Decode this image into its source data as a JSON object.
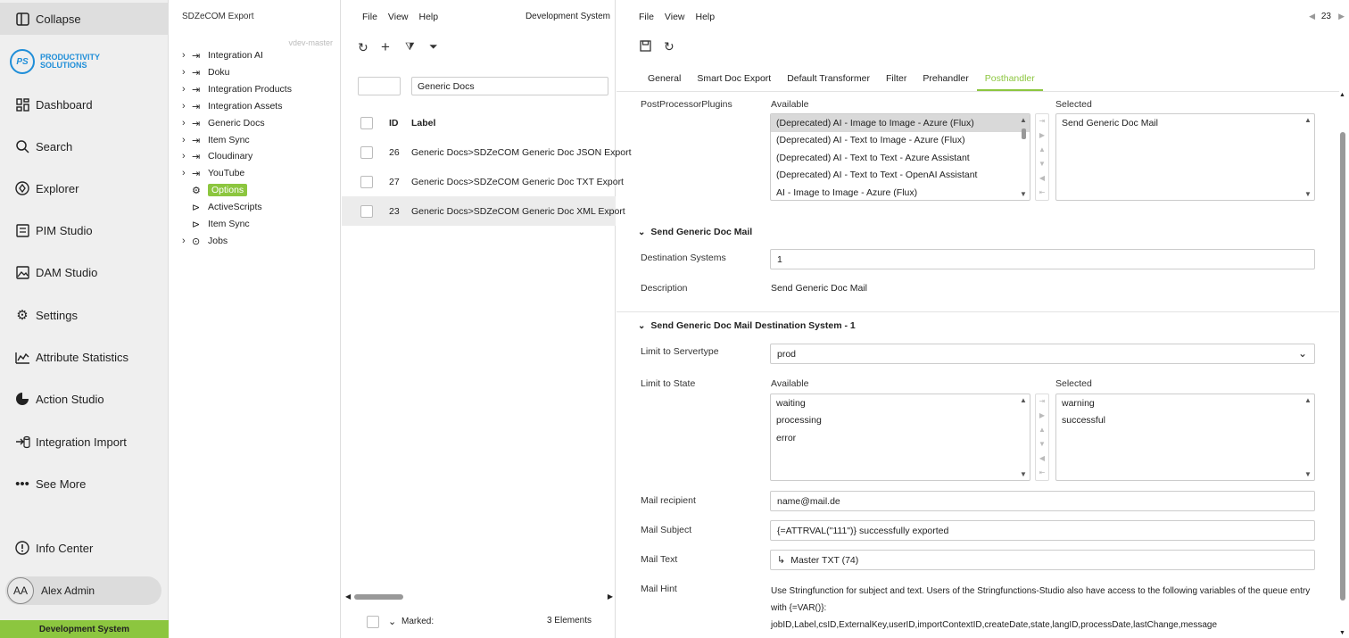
{
  "nav": {
    "collapse": "Collapse",
    "logo_initials": "PS",
    "logo_line1": "PRODUCTIVITY",
    "logo_line2": "SOLUTIONS",
    "items": [
      "Dashboard",
      "Search",
      "Explorer",
      "PIM Studio",
      "DAM Studio",
      "Settings",
      "Attribute Statistics",
      "Action Studio",
      "Integration Import",
      "See More"
    ],
    "info_center": "Info Center",
    "user_initials": "AA",
    "user_name": "Alex Admin",
    "environment": "Development System",
    "accent": "#8cc63f"
  },
  "tree": {
    "title": "SDZeCOM Export",
    "branch": "vdev-master",
    "nodes": [
      "Integration AI",
      "Doku",
      "Integration Products",
      "Integration Assets",
      "Generic Docs",
      "Item Sync",
      "Cloudinary",
      "YouTube",
      "Options",
      "ActiveScripts",
      "Item Sync",
      "Jobs"
    ]
  },
  "list": {
    "menu": [
      "File",
      "View",
      "Help"
    ],
    "system": "Development System",
    "filter_value": "Generic Docs",
    "col_id": "ID",
    "col_label": "Label",
    "rows": [
      {
        "id": "26",
        "label": "Generic Docs>SDZeCOM Generic Doc JSON Export"
      },
      {
        "id": "27",
        "label": "Generic Docs>SDZeCOM Generic Doc TXT Export"
      },
      {
        "id": "23",
        "label": "Generic Docs>SDZeCOM Generic Doc XML Export"
      }
    ],
    "marked_label": "Marked:",
    "count": "3 Elements"
  },
  "detail": {
    "menu": [
      "File",
      "View",
      "Help"
    ],
    "record_id": "23",
    "tabs": [
      "General",
      "Smart Doc Export",
      "Default Transformer",
      "Filter",
      "Prehandler",
      "Posthandler"
    ],
    "active_tab": "Posthandler",
    "ppp_label": "PostProcessorPlugins",
    "available": "Available",
    "selected": "Selected",
    "ppp_available": [
      "(Deprecated) AI - Image to Image - Azure (Flux)",
      "(Deprecated) AI - Text to Image - Azure (Flux)",
      "(Deprecated) AI - Text to Text - Azure Assistant",
      "(Deprecated) AI - Text to Text - OpenAI Assistant",
      "AI - Image to Image - Azure (Flux)"
    ],
    "ppp_selected": [
      "Send Generic Doc Mail"
    ],
    "section1": "Send Generic Doc Mail",
    "dest_label": "Destination Systems",
    "dest_value": "1",
    "desc_label": "Description",
    "desc_value": "Send Generic Doc Mail",
    "section2": "Send Generic Doc Mail Destination System - 1",
    "servertype_label": "Limit to Servertype",
    "servertype_value": "prod",
    "state_label": "Limit to State",
    "state_available": [
      "waiting",
      "processing",
      "error"
    ],
    "state_selected": [
      "warning",
      "successful"
    ],
    "recipient_label": "Mail recipient",
    "recipient_value": "name@mail.de",
    "subject_label": "Mail Subject",
    "subject_value": "{=ATTRVAL(\"111\")} successfully exported",
    "text_label": "Mail Text",
    "text_value": "Master TXT (74)",
    "hint_label": "Mail Hint",
    "hint_line1": "Use Stringfunction for subject and text. Users of the Stringfunctions-Studio also have access to the following variables of the queue entry",
    "hint_line2": "with {=VAR()}:",
    "hint_line3": "jobID,Label,csID,ExternalKey,userID,importContextID,createDate,state,langID,processDate,lastChange,message"
  }
}
